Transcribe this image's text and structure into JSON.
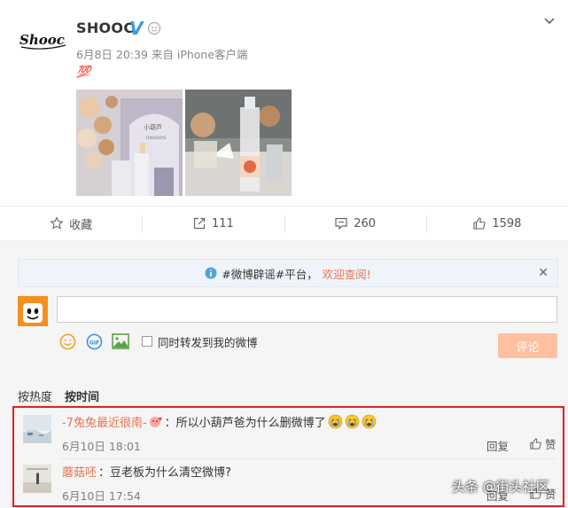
{
  "post": {
    "username": "SHOOC",
    "verified_mark": "V",
    "meta": "6月8日 20:39 来自 iPhone客户端",
    "emoji": "💯",
    "logo_text": "Shooc",
    "photo1_sign": "小葫芦",
    "photo1_sub": "1000DAYS"
  },
  "actions": {
    "favorite": "收藏",
    "repost": "111",
    "comment": "260",
    "like": "1598"
  },
  "notice": {
    "prefix": "#微博辟谣#平台，",
    "link": "欢迎查阅!"
  },
  "composer": {
    "repost_label": "同时转发到我的微博",
    "submit": "评论",
    "gif_label": "GIF"
  },
  "sort": {
    "hot": "按热度",
    "time": "按时间"
  },
  "comments": [
    {
      "user": "-7兔兔最近很南-",
      "text": "：所以小葫芦爸为什么删微博了",
      "time": "6月10日 18:01",
      "reply": "回复",
      "like": "赞"
    },
    {
      "user": "蘑菇呸",
      "text": "：豆老板为什么清空微博?",
      "time": "6月10日 17:54",
      "reply": "回复",
      "like": "赞"
    }
  ],
  "watermark": "头条 @街头社区",
  "colors": {
    "accent": "#eb7350",
    "verified": "#3a9bde",
    "submit_bg": "#ffc09f",
    "highlight_border": "#e02020"
  }
}
